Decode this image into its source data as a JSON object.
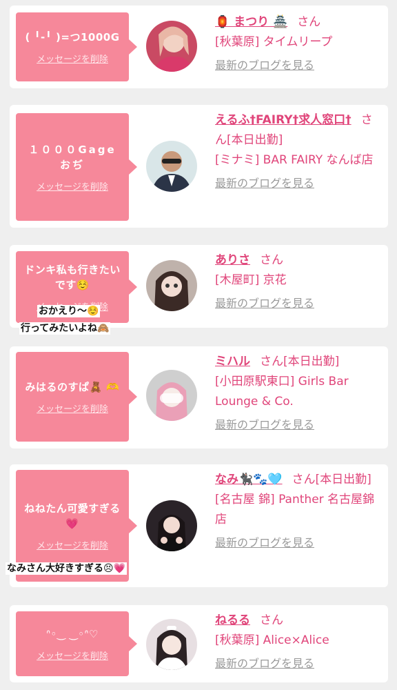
{
  "colors": {
    "bubble": "#f6889a",
    "pink_text": "#e0457a",
    "link_grey": "#9a9a9a",
    "page_bg": "#efefef"
  },
  "delete_label": "メッセージを削除",
  "san": "さん",
  "blog_label": "最新のブログを見る",
  "cards": [
    {
      "message": "( ╹-╹ )=つ1000G",
      "name": "🏮 まつり 🏯",
      "badge": "",
      "shop": "[秋葉原] タイムリープ"
    },
    {
      "message": "１０００Gage おぢ",
      "name": "えるふ†FAIRY†求人窓口†",
      "badge": "[本日出勤]",
      "shop": "[ミナミ] BAR FAIRY なんば店"
    },
    {
      "message": "ドンキ私も行きたいです☺️",
      "name": "ありさ",
      "badge": "",
      "shop": "[木屋町] 京花"
    },
    {
      "message": "みはるのすぱ🧸 🫶",
      "name": "ミハル",
      "badge": "[本日出勤]",
      "shop": "[小田原駅東口] Girls Bar Lounge & Co."
    },
    {
      "message": "ねねたん可愛すぎる💗",
      "name": "なみ🐈‍⬛🐾🩵",
      "badge": "[本日出勤]",
      "shop": "[名古屋 錦] Panther 名古屋錦店"
    },
    {
      "message": "ᐢ◦‿ ‿◦ᐢ♡",
      "name": "ねるる",
      "badge": "",
      "shop": "[秋葉原] Alice×Alice"
    }
  ],
  "overlays": {
    "o1": "おかえり〜☺️",
    "o2": "行ってみたいよね🙈",
    "o3": "なみさん大好きすぎる😣💗"
  }
}
